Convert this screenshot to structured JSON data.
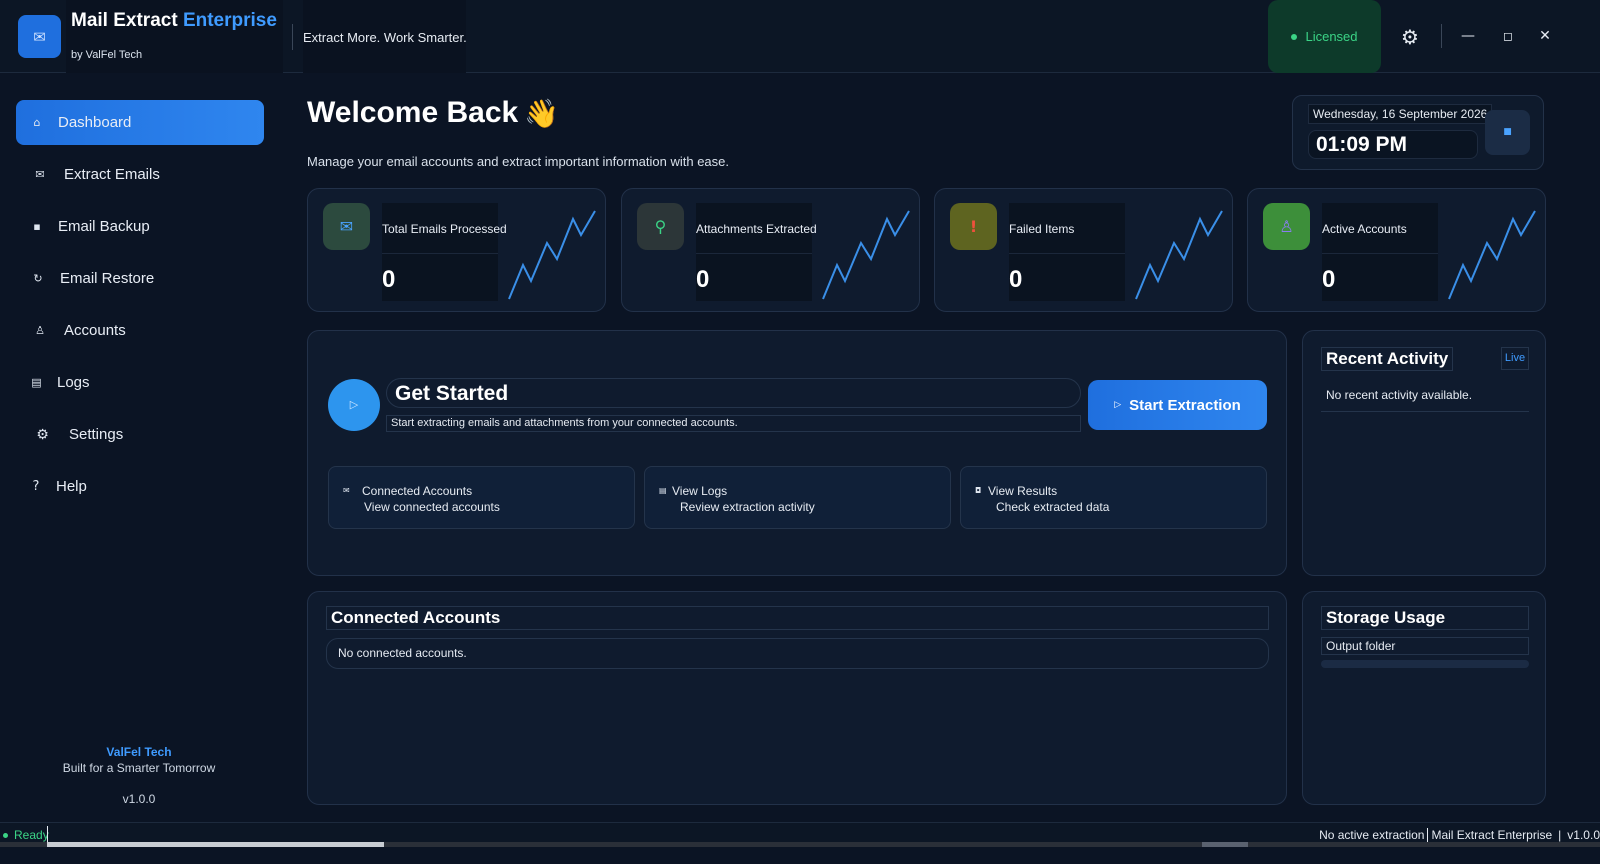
{
  "titlebar": {
    "logo_icon": "mail-icon",
    "app_name": "Mail Extract",
    "app_edition": "Enterprise",
    "by_line": "by ValFel Tech",
    "tagline": "Extract More. Work Smarter.",
    "license_status": "Licensed",
    "settings_icon": "gear-icon",
    "minimize": "—",
    "maximize": "◻",
    "close": "✕",
    "colors": {
      "accent": "#3f9bff",
      "license_green": "#3bd486"
    }
  },
  "sidebar": {
    "items": [
      {
        "label": "Dashboard",
        "icon": "home-icon",
        "glyph": "⌂",
        "active": true
      },
      {
        "label": "Extract Emails",
        "icon": "envelope-icon",
        "glyph": "✉"
      },
      {
        "label": "Email Backup",
        "icon": "backup-icon",
        "glyph": "▪"
      },
      {
        "label": "Email Restore",
        "icon": "restore-icon",
        "glyph": "↻"
      },
      {
        "label": "Accounts",
        "icon": "user-icon",
        "glyph": "♙"
      },
      {
        "label": "Logs",
        "icon": "logs-icon",
        "glyph": "▤"
      },
      {
        "label": "Settings",
        "icon": "gear-icon",
        "glyph": "⚙"
      },
      {
        "label": "Help",
        "icon": "help-icon",
        "glyph": "?"
      }
    ],
    "footer": {
      "brand": "ValFel Tech",
      "tagline": "Built for a Smarter Tomorrow",
      "version": "v1.0.0"
    }
  },
  "header": {
    "welcome": "Welcome Back",
    "wave_glyph": "👋",
    "subtitle": "Manage your email accounts and extract important information with ease.",
    "date": "Wednesday, 16 September 2026",
    "time": "01:09 PM",
    "clock_icon": "stop-icon"
  },
  "stats": [
    {
      "label": "Total Emails Processed",
      "value": "0",
      "icon": "envelope-icon",
      "glyph": "✉",
      "icon_bg": "#2c4a3e",
      "icon_color": "#4aa3ff"
    },
    {
      "label": "Attachments Extracted",
      "value": "0",
      "icon": "search-icon",
      "glyph": "⚲",
      "icon_bg": "#2c3638",
      "icon_color": "#3bd486"
    },
    {
      "label": "Failed Items",
      "value": "0",
      "icon": "warning-icon",
      "glyph": "!",
      "icon_bg": "#5e6420",
      "icon_color": "#f0503c"
    },
    {
      "label": "Active Accounts",
      "value": "0",
      "icon": "user-icon",
      "glyph": "♙",
      "icon_bg": "#3d8f3a",
      "icon_color": "#8a7df0"
    }
  ],
  "get_started": {
    "title": "Get Started",
    "description": "Start extracting emails and attachments from your connected accounts.",
    "play_icon": "play-icon",
    "start_button": "Start Extraction",
    "quick_cards": [
      {
        "title": "Connected Accounts",
        "subtitle": "View connected accounts",
        "icon": "envelope-icon",
        "glyph": "✉"
      },
      {
        "title": "View Logs",
        "subtitle": "Review extraction activity",
        "icon": "logs-icon",
        "glyph": "▤"
      },
      {
        "title": "View Results",
        "subtitle": "Check extracted data",
        "icon": "results-icon",
        "glyph": "◘"
      }
    ]
  },
  "recent_activity": {
    "title": "Recent Activity",
    "live": "Live",
    "empty": "No recent activity available."
  },
  "connected_accounts": {
    "title": "Connected Accounts",
    "empty": "No connected accounts."
  },
  "storage": {
    "title": "Storage Usage",
    "label": "Output folder",
    "fill_fraction": 0
  },
  "statusbar": {
    "status": "Ready",
    "extraction": "No active extraction",
    "app": "Mail Extract Enterprise",
    "version": "v1.0.0"
  }
}
